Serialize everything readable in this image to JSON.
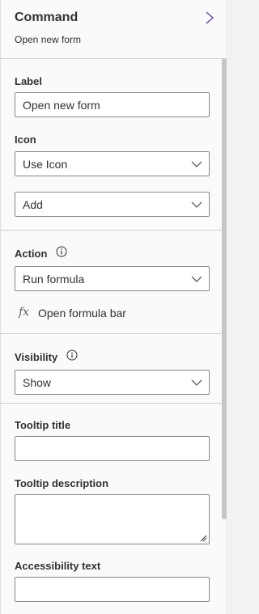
{
  "header": {
    "title": "Command",
    "subtitle": "Open new form",
    "expand_icon": "chevron-right-icon"
  },
  "label_section": {
    "label": "Label",
    "value": "Open new form"
  },
  "icon_section": {
    "label": "Icon",
    "type_value": "Use Icon",
    "icon_value": "Add"
  },
  "action_section": {
    "label": "Action",
    "value": "Run formula",
    "formula_link_icon": "fx",
    "formula_link": "Open formula bar"
  },
  "visibility_section": {
    "label": "Visibility",
    "value": "Show"
  },
  "tooltip_section": {
    "title_label": "Tooltip title",
    "title_value": "",
    "description_label": "Tooltip description",
    "description_value": ""
  },
  "accessibility_section": {
    "label": "Accessibility text",
    "value": ""
  },
  "colors": {
    "panel_bg": "#fafafa",
    "border": "#8a8886",
    "divider": "#d2d0ce",
    "accent": "#7a5fa8"
  }
}
